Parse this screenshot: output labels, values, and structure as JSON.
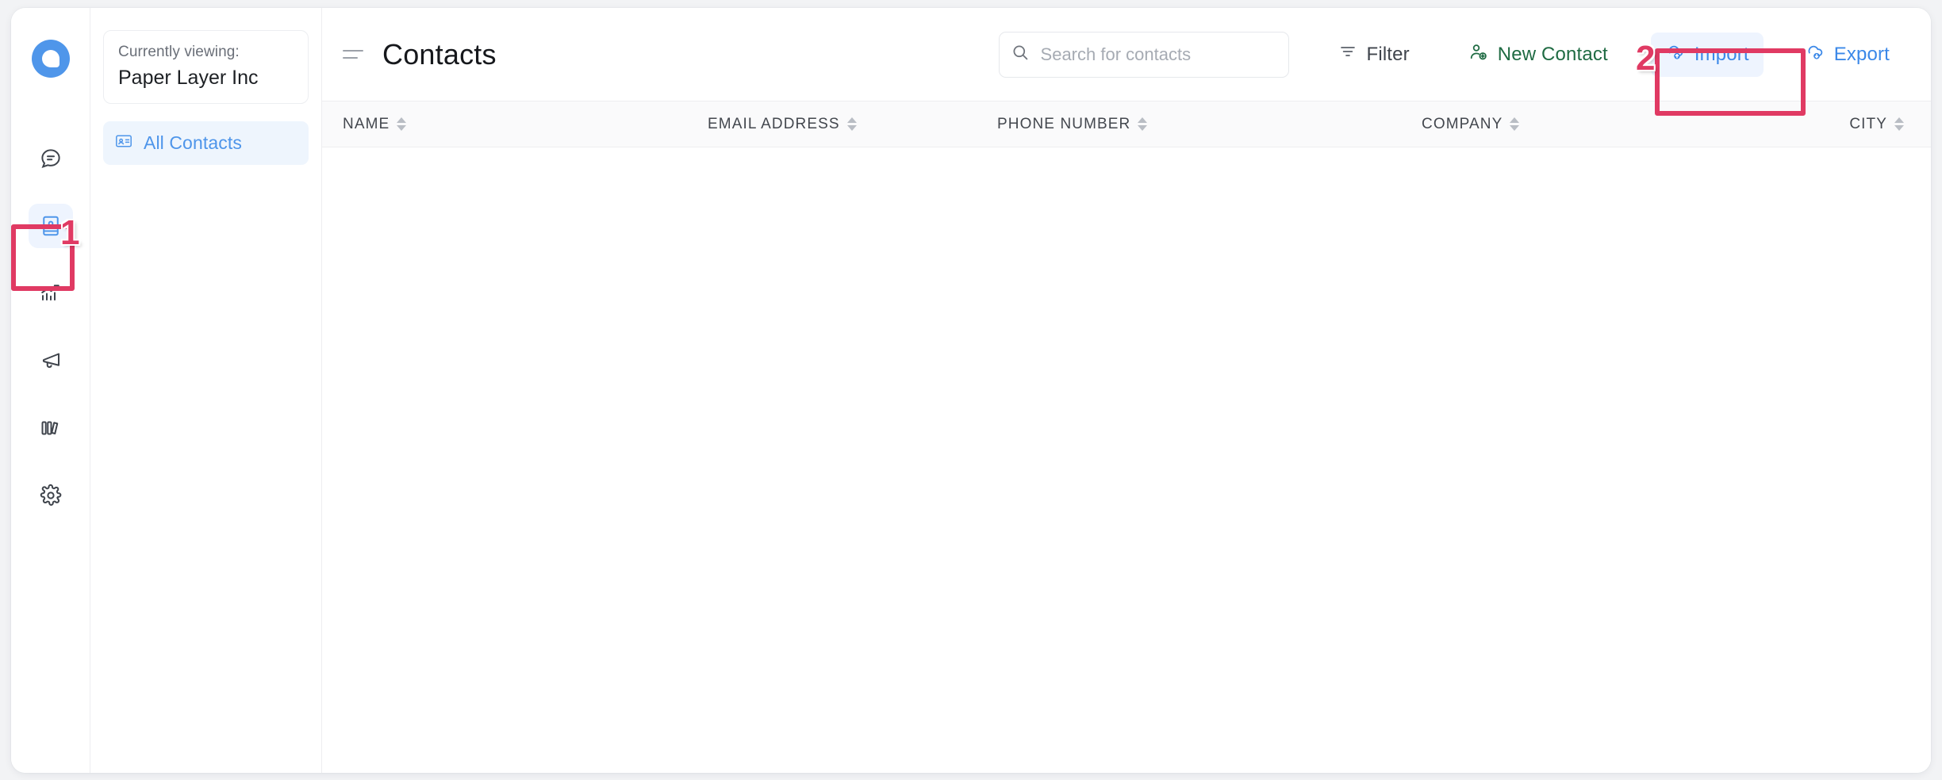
{
  "brand": {
    "logo_icon": "chat-bubble-logo"
  },
  "rail": {
    "items": [
      {
        "icon": "chat-bubble-icon",
        "name": "messages",
        "active": false
      },
      {
        "icon": "contacts-book-icon",
        "name": "contacts",
        "active": true
      },
      {
        "icon": "analytics-chart-icon",
        "name": "analytics",
        "active": false
      },
      {
        "icon": "megaphone-icon",
        "name": "campaigns",
        "active": false
      },
      {
        "icon": "library-books-icon",
        "name": "library",
        "active": false
      },
      {
        "icon": "gear-icon",
        "name": "settings",
        "active": false
      }
    ]
  },
  "nav_panel": {
    "viewing_label": "Currently viewing:",
    "organization": "Paper Layer Inc",
    "items": [
      {
        "label": "All Contacts",
        "icon": "contact-card-icon",
        "active": true
      }
    ]
  },
  "header": {
    "menu_icon": "hamburger-icon",
    "title": "Contacts"
  },
  "search": {
    "icon": "search-icon",
    "placeholder": "Search for contacts",
    "value": ""
  },
  "toolbar": {
    "filter_label": "Filter",
    "filter_icon": "filter-funnel-icon",
    "new_contact_label": "New Contact",
    "new_contact_icon": "user-plus-icon",
    "import_label": "Import",
    "import_icon": "cloud-upload-icon",
    "export_label": "Export",
    "export_icon": "cloud-download-icon"
  },
  "table": {
    "columns": [
      {
        "label": "NAME",
        "sort_icon": "sort-arrows-icon"
      },
      {
        "label": "EMAIL ADDRESS",
        "sort_icon": "sort-arrows-icon"
      },
      {
        "label": "PHONE NUMBER",
        "sort_icon": "sort-arrows-icon"
      },
      {
        "label": "COMPANY",
        "sort_icon": "sort-arrows-icon"
      },
      {
        "label": "CITY",
        "sort_icon": "sort-arrows-icon"
      }
    ],
    "rows": []
  },
  "annotations": [
    {
      "number": "1",
      "target": "contacts-rail-item"
    },
    {
      "number": "2",
      "target": "import-button"
    }
  ],
  "colors": {
    "brand_blue": "#4f96ea",
    "link_blue": "#3b88e8",
    "green": "#1f6b43",
    "annotation_red": "#e03a63",
    "page_background": "#f2f3f5"
  }
}
